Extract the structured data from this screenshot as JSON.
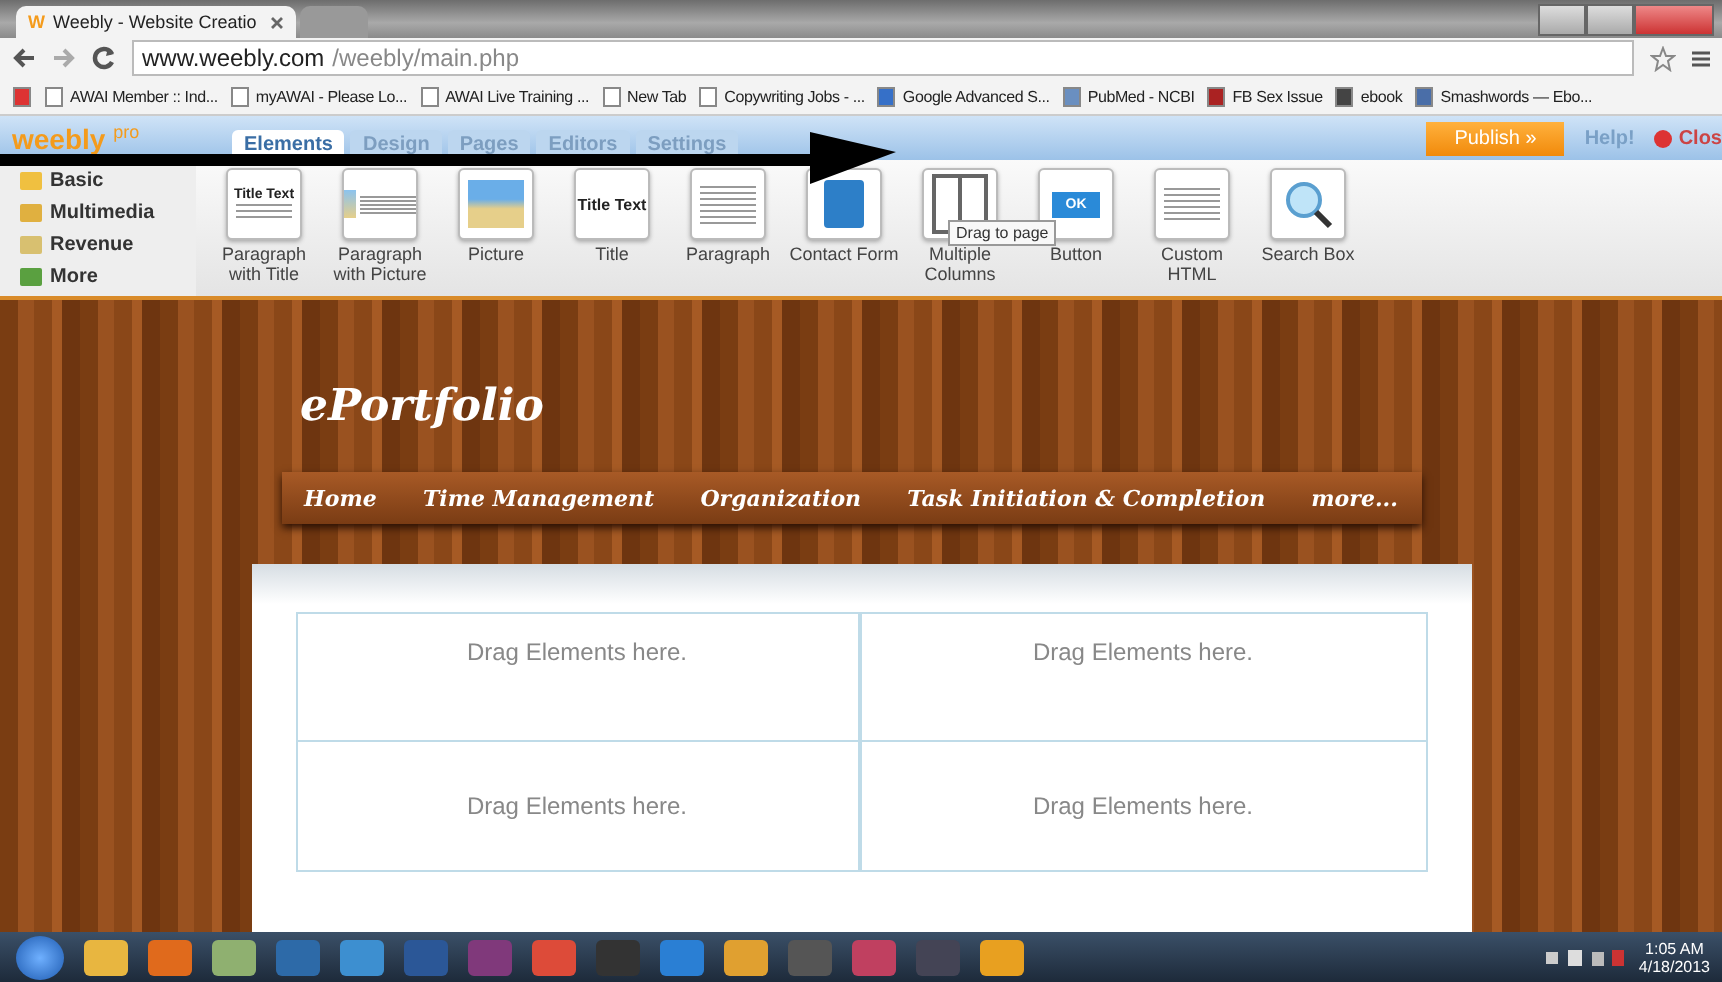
{
  "browser": {
    "tabs": [
      {
        "title": "Weebly - Website Creatio",
        "favicon": "W",
        "selected": true
      },
      {
        "selected": false
      }
    ],
    "url": {
      "host": "www.weebly.com",
      "path": "/weebly/main.php"
    },
    "bookmarks": [
      {
        "kind": "gmail"
      },
      {
        "label": "AWAI Member :: Ind...",
        "kind": "page"
      },
      {
        "label": "myAWAI - Please Lo...",
        "kind": "page"
      },
      {
        "label": "AWAI Live Training ...",
        "kind": "page"
      },
      {
        "label": "New Tab",
        "kind": "page"
      },
      {
        "label": "Copywriting Jobs - ...",
        "kind": "page"
      },
      {
        "label": "Google Advanced S...",
        "kind": "google"
      },
      {
        "label": "PubMed - NCBI",
        "kind": "pubmed"
      },
      {
        "label": "FB Sex Issue",
        "kind": "fb"
      },
      {
        "label": "ebook",
        "kind": "ebook"
      },
      {
        "label": "Smashwords — Ebo...",
        "kind": "globe"
      }
    ]
  },
  "editor": {
    "logo": "weebly",
    "logo_badge": "pro",
    "tabs": [
      {
        "label": "Elements",
        "selected": true
      },
      {
        "label": "Design",
        "selected": false
      },
      {
        "label": "Pages",
        "selected": false
      },
      {
        "label": "Editors",
        "selected": false
      },
      {
        "label": "Settings",
        "selected": false
      }
    ],
    "publish": "Publish »",
    "help": "Help!",
    "close": "Clos",
    "categories": [
      {
        "label": "Basic",
        "kind": "basic"
      },
      {
        "label": "Multimedia",
        "kind": "media"
      },
      {
        "label": "Revenue",
        "kind": "revenue"
      },
      {
        "label": "More",
        "kind": "more"
      }
    ],
    "elements": [
      {
        "label": "Paragraph with Title",
        "kind": "text-title",
        "thumb_text": "Title Text"
      },
      {
        "label": "Paragraph with Picture",
        "kind": "text-picture"
      },
      {
        "label": "Picture",
        "kind": "picture"
      },
      {
        "label": "Title",
        "kind": "title",
        "thumb_text": "Title Text"
      },
      {
        "label": "Paragraph",
        "kind": "paragraph"
      },
      {
        "label": "Contact Form",
        "kind": "contact"
      },
      {
        "label": "Multiple Columns",
        "kind": "columns",
        "tooltip": "Drag to page"
      },
      {
        "label": "Button",
        "kind": "button",
        "thumb_text": "OK"
      },
      {
        "label": "Custom HTML",
        "kind": "html"
      },
      {
        "label": "Search Box",
        "kind": "search"
      }
    ]
  },
  "site": {
    "title": "ePortfolio",
    "nav": [
      "Home",
      "Time Management",
      "Organization",
      "Task Initiation & Completion",
      "more..."
    ],
    "drop_zones": [
      "Drag Elements here.",
      "Drag Elements here.",
      "Drag Elements here.",
      "Drag Elements here."
    ]
  },
  "taskbar": {
    "time": "1:05 AM",
    "date": "4/18/2013"
  }
}
